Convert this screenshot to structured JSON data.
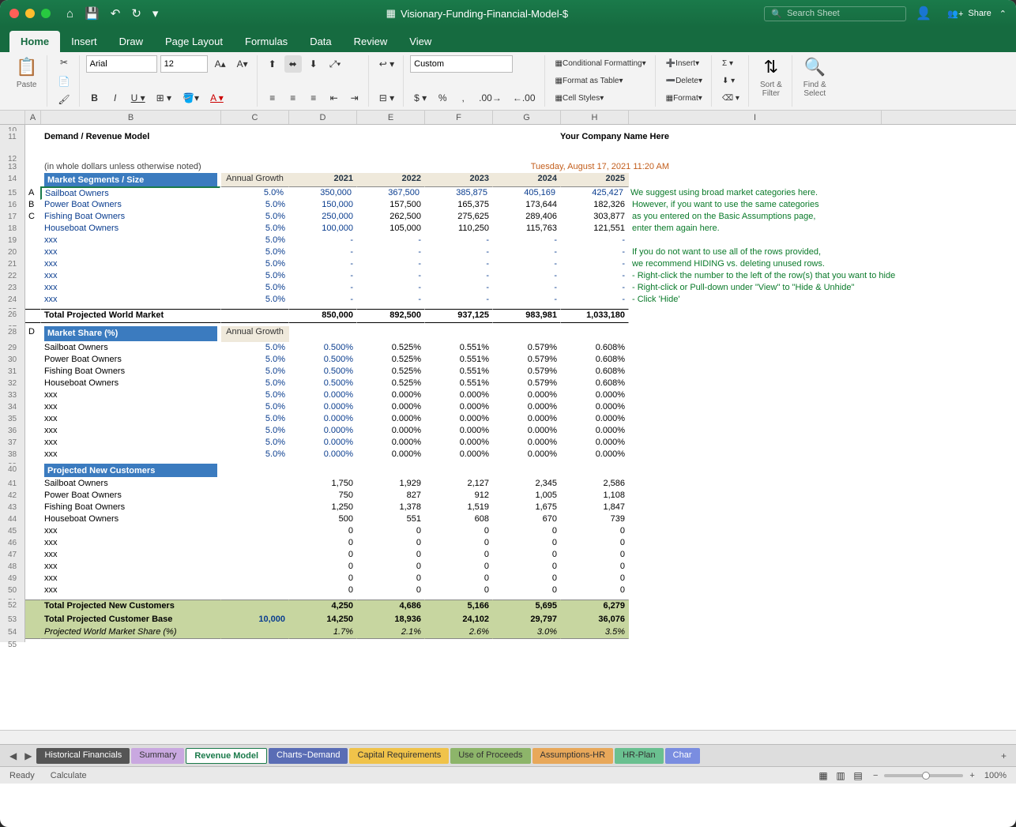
{
  "window": {
    "title": "Visionary-Funding-Financial-Model-$",
    "searchPlaceholder": "Search Sheet",
    "share": "Share"
  },
  "tabs": [
    "Home",
    "Insert",
    "Draw",
    "Page Layout",
    "Formulas",
    "Data",
    "Review",
    "View"
  ],
  "activeTab": "Home",
  "ribbon": {
    "paste": "Paste",
    "font": {
      "name": "Arial",
      "size": "12"
    },
    "numberFormat": "Custom",
    "cond": "Conditional Formatting",
    "table": "Format as Table",
    "styles": "Cell Styles",
    "insert": "Insert",
    "delete": "Delete",
    "format": "Format",
    "sortFilter": "Sort &\nFilter",
    "findSelect": "Find &\nSelect"
  },
  "columns": [
    "A",
    "B",
    "C",
    "D",
    "E",
    "F",
    "G",
    "H",
    "I"
  ],
  "doc": {
    "title": "Demand / Revenue Model",
    "company": "Your Company Name Here",
    "note": "(in whole dollars unless otherwise noted)",
    "timestamp": "Tuesday, August 17, 2021 11:20 AM",
    "sec1": "Market Segments / Size",
    "annualGrowth": "Annual Growth",
    "years": [
      "2021",
      "2022",
      "2023",
      "2024",
      "2025"
    ],
    "segRows": [
      {
        "n": "15",
        "l": "A",
        "name": "Sailboat Owners",
        "g": "5.0%",
        "v": [
          "350,000",
          "367,500",
          "385,875",
          "405,169",
          "425,427"
        ]
      },
      {
        "n": "16",
        "l": "B",
        "name": "Power Boat Owners",
        "g": "5.0%",
        "v": [
          "150,000",
          "157,500",
          "165,375",
          "173,644",
          "182,326"
        ]
      },
      {
        "n": "17",
        "l": "C",
        "name": "Fishing Boat Owners",
        "g": "5.0%",
        "v": [
          "250,000",
          "262,500",
          "275,625",
          "289,406",
          "303,877"
        ]
      },
      {
        "n": "18",
        "l": "",
        "name": "Houseboat Owners",
        "g": "5.0%",
        "v": [
          "100,000",
          "105,000",
          "110,250",
          "115,763",
          "121,551"
        ]
      },
      {
        "n": "19",
        "l": "",
        "name": "xxx",
        "g": "5.0%",
        "v": [
          "-",
          "-",
          "-",
          "-",
          "-"
        ]
      },
      {
        "n": "20",
        "l": "",
        "name": "xxx",
        "g": "5.0%",
        "v": [
          "-",
          "-",
          "-",
          "-",
          "-"
        ]
      },
      {
        "n": "21",
        "l": "",
        "name": "xxx",
        "g": "5.0%",
        "v": [
          "-",
          "-",
          "-",
          "-",
          "-"
        ]
      },
      {
        "n": "22",
        "l": "",
        "name": "xxx",
        "g": "5.0%",
        "v": [
          "-",
          "-",
          "-",
          "-",
          "-"
        ]
      },
      {
        "n": "23",
        "l": "",
        "name": "xxx",
        "g": "5.0%",
        "v": [
          "-",
          "-",
          "-",
          "-",
          "-"
        ]
      },
      {
        "n": "24",
        "l": "",
        "name": "xxx",
        "g": "5.0%",
        "v": [
          "-",
          "-",
          "-",
          "-",
          "-"
        ]
      }
    ],
    "tot1": {
      "label": "Total Projected World Market",
      "v": [
        "850,000",
        "892,500",
        "937,125",
        "983,981",
        "1,033,180"
      ]
    },
    "sec2": "Market Share (%)",
    "shareRows": [
      {
        "n": "29",
        "name": "Sailboat Owners",
        "g": "5.0%",
        "v": [
          "0.500%",
          "0.525%",
          "0.551%",
          "0.579%",
          "0.608%"
        ]
      },
      {
        "n": "30",
        "name": "Power Boat Owners",
        "g": "5.0%",
        "v": [
          "0.500%",
          "0.525%",
          "0.551%",
          "0.579%",
          "0.608%"
        ]
      },
      {
        "n": "31",
        "name": "Fishing Boat Owners",
        "g": "5.0%",
        "v": [
          "0.500%",
          "0.525%",
          "0.551%",
          "0.579%",
          "0.608%"
        ]
      },
      {
        "n": "32",
        "name": "Houseboat Owners",
        "g": "5.0%",
        "v": [
          "0.500%",
          "0.525%",
          "0.551%",
          "0.579%",
          "0.608%"
        ]
      },
      {
        "n": "33",
        "name": "xxx",
        "g": "5.0%",
        "v": [
          "0.000%",
          "0.000%",
          "0.000%",
          "0.000%",
          "0.000%"
        ]
      },
      {
        "n": "34",
        "name": "xxx",
        "g": "5.0%",
        "v": [
          "0.000%",
          "0.000%",
          "0.000%",
          "0.000%",
          "0.000%"
        ]
      },
      {
        "n": "35",
        "name": "xxx",
        "g": "5.0%",
        "v": [
          "0.000%",
          "0.000%",
          "0.000%",
          "0.000%",
          "0.000%"
        ]
      },
      {
        "n": "36",
        "name": "xxx",
        "g": "5.0%",
        "v": [
          "0.000%",
          "0.000%",
          "0.000%",
          "0.000%",
          "0.000%"
        ]
      },
      {
        "n": "37",
        "name": "xxx",
        "g": "5.0%",
        "v": [
          "0.000%",
          "0.000%",
          "0.000%",
          "0.000%",
          "0.000%"
        ]
      },
      {
        "n": "38",
        "name": "xxx",
        "g": "5.0%",
        "v": [
          "0.000%",
          "0.000%",
          "0.000%",
          "0.000%",
          "0.000%"
        ]
      }
    ],
    "sec3": "Projected New Customers",
    "custRows": [
      {
        "n": "41",
        "name": "Sailboat Owners",
        "v": [
          "1,750",
          "1,929",
          "2,127",
          "2,345",
          "2,586"
        ]
      },
      {
        "n": "42",
        "name": "Power Boat Owners",
        "v": [
          "750",
          "827",
          "912",
          "1,005",
          "1,108"
        ]
      },
      {
        "n": "43",
        "name": "Fishing Boat Owners",
        "v": [
          "1,250",
          "1,378",
          "1,519",
          "1,675",
          "1,847"
        ]
      },
      {
        "n": "44",
        "name": "Houseboat Owners",
        "v": [
          "500",
          "551",
          "608",
          "670",
          "739"
        ]
      },
      {
        "n": "45",
        "name": "xxx",
        "v": [
          "0",
          "0",
          "0",
          "0",
          "0"
        ]
      },
      {
        "n": "46",
        "name": "xxx",
        "v": [
          "0",
          "0",
          "0",
          "0",
          "0"
        ]
      },
      {
        "n": "47",
        "name": "xxx",
        "v": [
          "0",
          "0",
          "0",
          "0",
          "0"
        ]
      },
      {
        "n": "48",
        "name": "xxx",
        "v": [
          "0",
          "0",
          "0",
          "0",
          "0"
        ]
      },
      {
        "n": "49",
        "name": "xxx",
        "v": [
          "0",
          "0",
          "0",
          "0",
          "0"
        ]
      },
      {
        "n": "50",
        "name": "xxx",
        "v": [
          "0",
          "0",
          "0",
          "0",
          "0"
        ]
      }
    ],
    "tot2": {
      "label": "Total Projected New Customers",
      "v": [
        "4,250",
        "4,686",
        "5,166",
        "5,695",
        "6,279"
      ]
    },
    "tot3": {
      "label": "Total Projected Customer Base",
      "base": "10,000",
      "v": [
        "14,250",
        "18,936",
        "24,102",
        "29,797",
        "36,076"
      ]
    },
    "tot4": {
      "label": "Projected World Market Share (%)",
      "v": [
        "1.7%",
        "2.1%",
        "2.6%",
        "3.0%",
        "3.5%"
      ]
    },
    "hints": [
      "We suggest using broad market categories here.",
      "However, if you want to use the same categories",
      "as you entered on the Basic Assumptions page,",
      "enter them again here.",
      "",
      "If you do not want to use all of the rows provided,",
      "we recommend HIDING vs. deleting unused rows.",
      "- Right-click the number to the left of the row(s) that you want to hide",
      "- Right-click or Pull-down under \"View\" to \"Hide & Unhide\"",
      "- Click 'Hide'"
    ]
  },
  "sheets": [
    {
      "label": "Historical Financials",
      "bg": "#555",
      "fg": "#fff"
    },
    {
      "label": "Summary",
      "bg": "#c9a8e0",
      "fg": "#333"
    },
    {
      "label": "Revenue Model",
      "bg": "#fff",
      "fg": "#1a7a4a",
      "active": true
    },
    {
      "label": "Charts~Demand",
      "bg": "#5a6db5",
      "fg": "#fff"
    },
    {
      "label": "Capital Requirements",
      "bg": "#f0c34a",
      "fg": "#333"
    },
    {
      "label": "Use of Proceeds",
      "bg": "#8db56a",
      "fg": "#333"
    },
    {
      "label": "Assumptions-HR",
      "bg": "#e8a85a",
      "fg": "#333"
    },
    {
      "label": "HR-Plan",
      "bg": "#6ac090",
      "fg": "#333"
    },
    {
      "label": "Char",
      "bg": "#7a8de0",
      "fg": "#fff"
    }
  ],
  "status": {
    "ready": "Ready",
    "calc": "Calculate",
    "zoom": "100%"
  }
}
